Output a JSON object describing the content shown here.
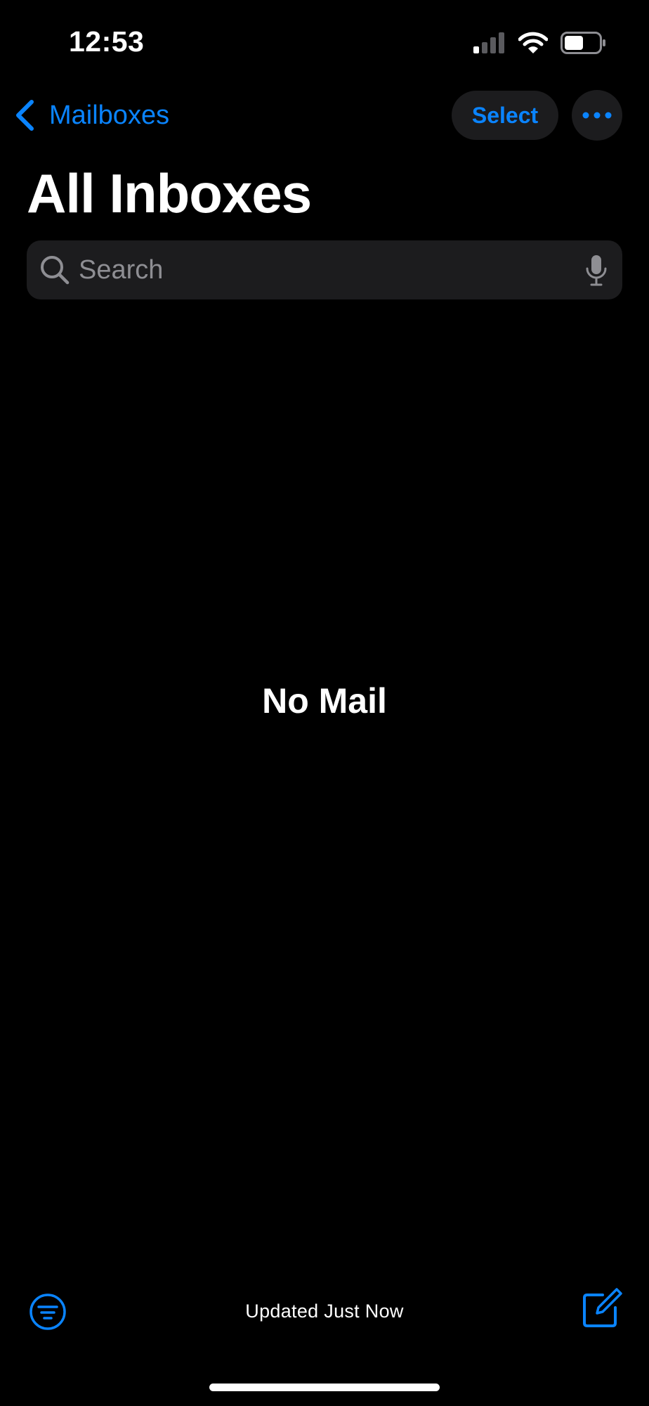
{
  "status_bar": {
    "time": "12:53",
    "icons": [
      "cellular-signal-icon",
      "wifi-icon",
      "battery-icon"
    ]
  },
  "nav": {
    "back_label": "Mailboxes",
    "select_label": "Select",
    "more_icon": "ellipsis-icon"
  },
  "title": "All Inboxes",
  "search": {
    "value": "",
    "placeholder": "Search",
    "icon": "search-icon",
    "mic_icon": "microphone-icon"
  },
  "empty_state": "No Mail",
  "toolbar": {
    "filter_icon": "filter-icon",
    "status": "Updated Just Now",
    "compose_icon": "compose-icon"
  },
  "colors": {
    "background": "#000000",
    "accent": "#0a84ff",
    "control_fill": "#1c1c1e",
    "placeholder": "#8e8e93",
    "text": "#ffffff"
  }
}
